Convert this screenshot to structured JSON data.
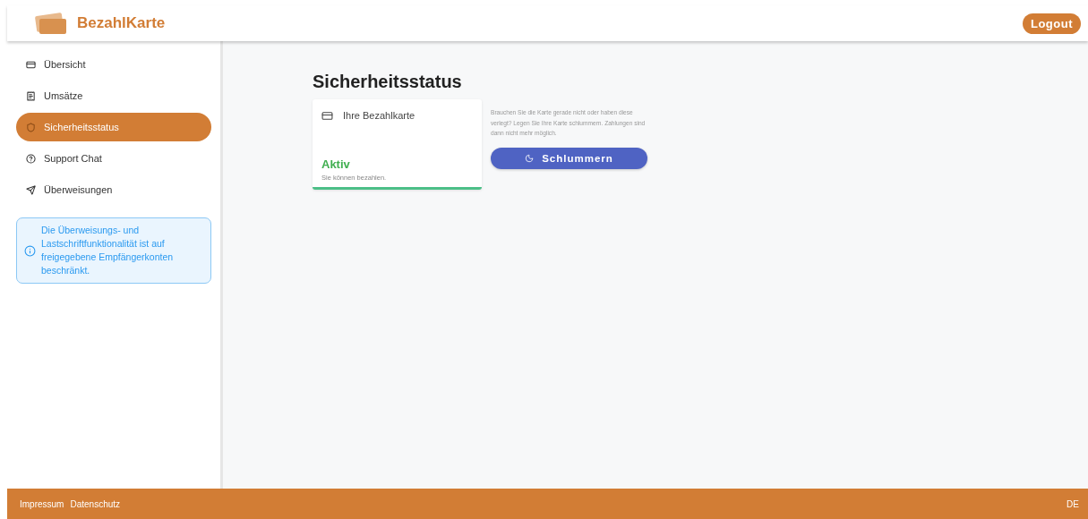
{
  "header": {
    "brand": "BezahlKarte",
    "logout": "Logout"
  },
  "sidebar": {
    "items": [
      {
        "kind": "card",
        "label": "Übersicht",
        "selected": false
      },
      {
        "kind": "receipt",
        "label": "Umsätze",
        "selected": false
      },
      {
        "kind": "shield",
        "label": "Sicherheitsstatus",
        "selected": true
      },
      {
        "kind": "help",
        "label": "Support Chat",
        "selected": false
      },
      {
        "kind": "send",
        "label": "Überweisungen",
        "selected": false
      }
    ],
    "notice": "Die Überweisungs- und Lastschriftfunktionalität ist auf freigegebene Empfängerkonten beschränkt."
  },
  "main": {
    "title": "Sicherheitsstatus",
    "card": {
      "label": "Ihre Bezahlkarte",
      "status": "Aktiv",
      "status_text": "Sie können bezahlen.",
      "active": true
    },
    "hint": "Brauchen Sie die Karte gerade nicht oder haben diese verlegt? Legen Sie Ihre Karte schlummern. Zahlungen sind dann nicht mehr möglich.",
    "button": "Schlummern"
  },
  "footer": {
    "links": [
      "Impressum",
      "Datenschutz"
    ],
    "language": "DE"
  }
}
